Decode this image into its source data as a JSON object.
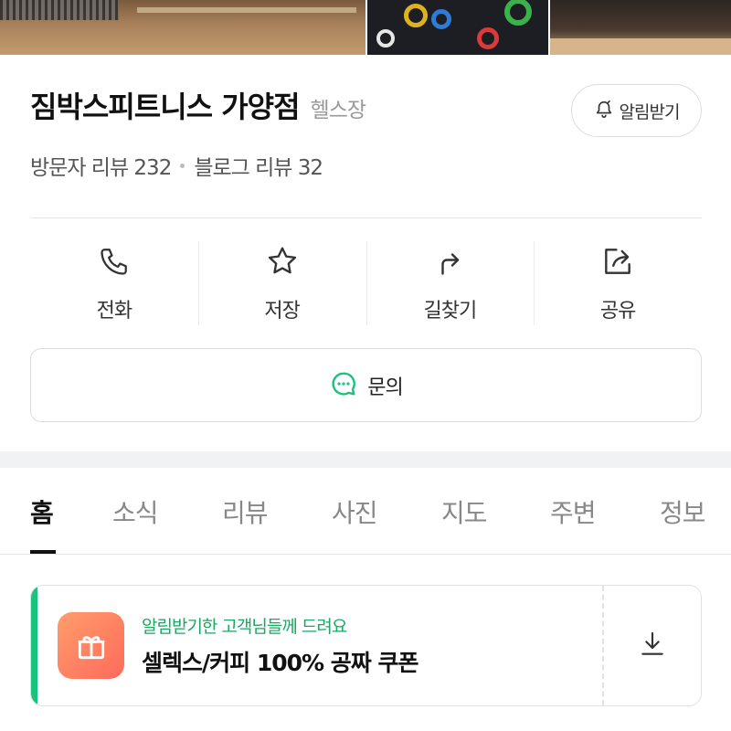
{
  "place": {
    "name": "짐박스피트니스 가양점",
    "category": "헬스장",
    "alarm_label": "알림받기",
    "visitor_reviews": "방문자 리뷰 232",
    "blog_reviews": "블로그 리뷰 32"
  },
  "actions": [
    {
      "label": "전화",
      "icon": "phone-icon"
    },
    {
      "label": "저장",
      "icon": "star-icon"
    },
    {
      "label": "길찾기",
      "icon": "directions-icon"
    },
    {
      "label": "공유",
      "icon": "share-icon"
    }
  ],
  "inquiry": {
    "label": "문의",
    "icon": "chat-bubble-icon"
  },
  "tabs": [
    {
      "label": "홈",
      "active": true
    },
    {
      "label": "소식"
    },
    {
      "label": "리뷰"
    },
    {
      "label": "사진"
    },
    {
      "label": "지도"
    },
    {
      "label": "주변"
    },
    {
      "label": "정보"
    }
  ],
  "coupon": {
    "subtitle": "알림받기한 고객님들께 드려요",
    "title": "셀렉스/커피 100% 공짜 쿠폰",
    "icon": "gift-icon",
    "action_icon": "download-icon"
  },
  "colors": {
    "accent_green": "#19c37d",
    "coupon_gradient_start": "#ff9d6c",
    "coupon_gradient_end": "#ff6a5a"
  }
}
